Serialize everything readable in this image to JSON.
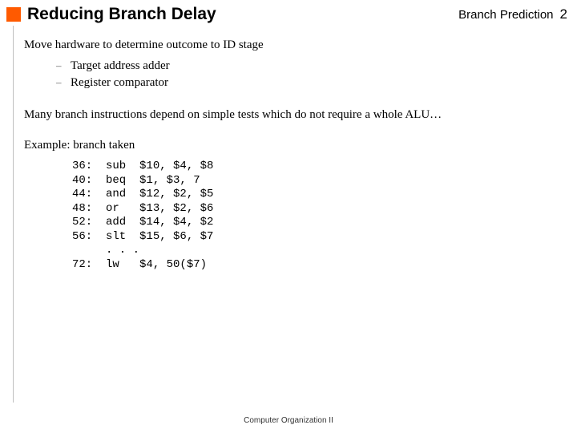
{
  "header": {
    "title": "Reducing Branch Delay",
    "topic": "Branch Prediction",
    "page": "2"
  },
  "body": {
    "lead": "Move hardware to determine outcome to ID stage",
    "sub1": "Target address adder",
    "sub2": "Register comparator",
    "para": "Many branch instructions depend on simple tests which do not require a whole ALU…",
    "example_title": "Example: branch taken",
    "code": "36:  sub  $10, $4, $8\n40:  beq  $1, $3, 7\n44:  and  $12, $2, $5\n48:  or   $13, $2, $6\n52:  add  $14, $4, $2\n56:  slt  $15, $6, $7\n     . . .\n72:  lw   $4, 50($7)"
  },
  "footer": "Computer Organization II"
}
